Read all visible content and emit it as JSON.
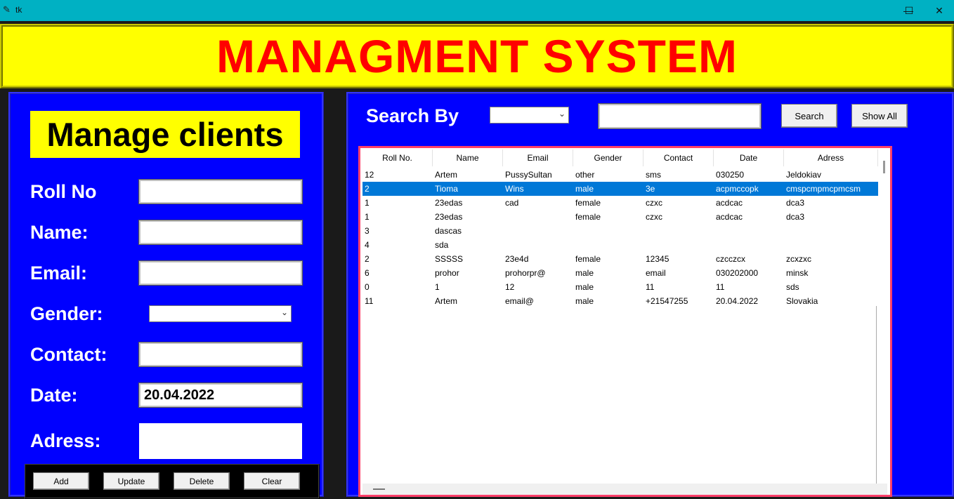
{
  "window": {
    "title": "tk",
    "minimize": "—",
    "maximize": "☐",
    "close": "✕"
  },
  "header": {
    "title": "MANAGMENT SYSTEM"
  },
  "left": {
    "heading": "Manage clients",
    "labels": {
      "roll": "Roll No",
      "name": "Name:",
      "email": "Email:",
      "gender": "Gender:",
      "contact": "Contact:",
      "date": "Date:",
      "adress": "Adress:"
    },
    "values": {
      "roll": "",
      "name": "",
      "email": "",
      "gender": "",
      "contact": "",
      "date": "20.04.2022",
      "adress": ""
    },
    "buttons": {
      "add": "Add",
      "update": "Update",
      "delete": "Delete",
      "clear": "Clear"
    }
  },
  "right": {
    "search_label": "Search By",
    "search_by_value": "",
    "search_text": "",
    "search_button": "Search",
    "show_all_button": "Show All"
  },
  "table": {
    "columns": [
      "Roll No.",
      "Name",
      "Email",
      "Gender",
      "Contact",
      "Date",
      "Adress"
    ],
    "selected_row": 1,
    "rows": [
      [
        "12",
        "Artem",
        "PussySultan",
        "other",
        "sms",
        "030250",
        "Jeldokiav"
      ],
      [
        "2",
        "Tioma",
        "Wins",
        "male",
        "3e",
        "acpmccopk",
        "cmspcmpmcpmcsm"
      ],
      [
        "1",
        "23edas",
        "cad",
        "female",
        "czxc",
        "acdcac",
        "dca3"
      ],
      [
        "1",
        "23edas",
        "",
        "female",
        "czxc",
        "acdcac",
        "dca3"
      ],
      [
        "3",
        "dascas",
        "",
        "",
        "",
        "",
        ""
      ],
      [
        "4",
        "sda",
        "",
        "",
        "",
        "",
        ""
      ],
      [
        "2",
        "SSSSS",
        "23e4d",
        "female",
        "12345",
        "czcczcx",
        "zcxzxc"
      ],
      [
        "6",
        "prohor",
        "prohorpr@",
        "male",
        "email",
        "030202000",
        "minsk"
      ],
      [
        "0",
        "1",
        "12",
        "male",
        "11",
        "11",
        "sds"
      ],
      [
        "11",
        "Artem",
        "email@",
        "male",
        "+21547255",
        "20.04.2022",
        "Slovakia"
      ]
    ]
  },
  "colors": {
    "accent": "#0000ff",
    "header_bg": "#ffff00",
    "header_text": "#ff0000",
    "selection": "#0078d7",
    "titlebar": "#00b1c3"
  }
}
